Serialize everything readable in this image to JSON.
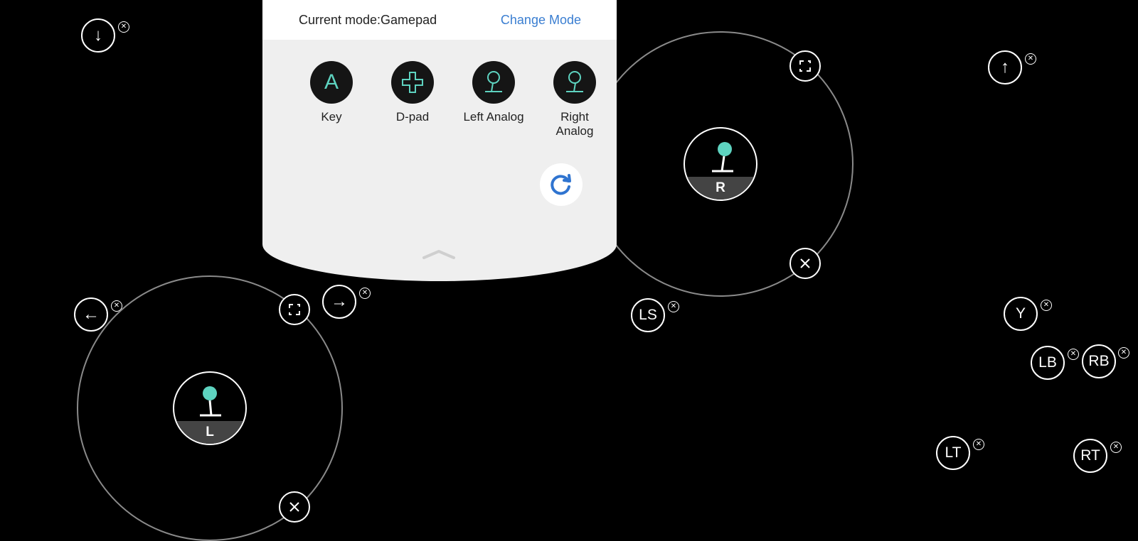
{
  "panel": {
    "mode_label": "Current mode:Gamepad",
    "change_mode": "Change Mode",
    "tools": [
      {
        "label": "Key",
        "icon": "key-a-icon",
        "glyph": "A"
      },
      {
        "label": "D-pad",
        "icon": "dpad-icon"
      },
      {
        "label": "Left Analog",
        "icon": "left-analog-icon"
      },
      {
        "label": "Right Analog",
        "icon": "right-analog-icon"
      }
    ],
    "refresh_icon": "refresh-icon",
    "collapse_icon": "chevron-up-icon"
  },
  "arrows": {
    "down": "↓",
    "up": "↑",
    "left": "←",
    "right": "→"
  },
  "buttons": {
    "ls": "LS",
    "y": "Y",
    "lb": "LB",
    "rb": "RB",
    "lt": "LT",
    "rt": "RT"
  },
  "sticks": {
    "left_label": "L",
    "right_label": "R"
  },
  "colors": {
    "accent_teal": "#5ed3c0",
    "link_blue": "#3a7ed1",
    "panel_bg": "#efefef"
  }
}
